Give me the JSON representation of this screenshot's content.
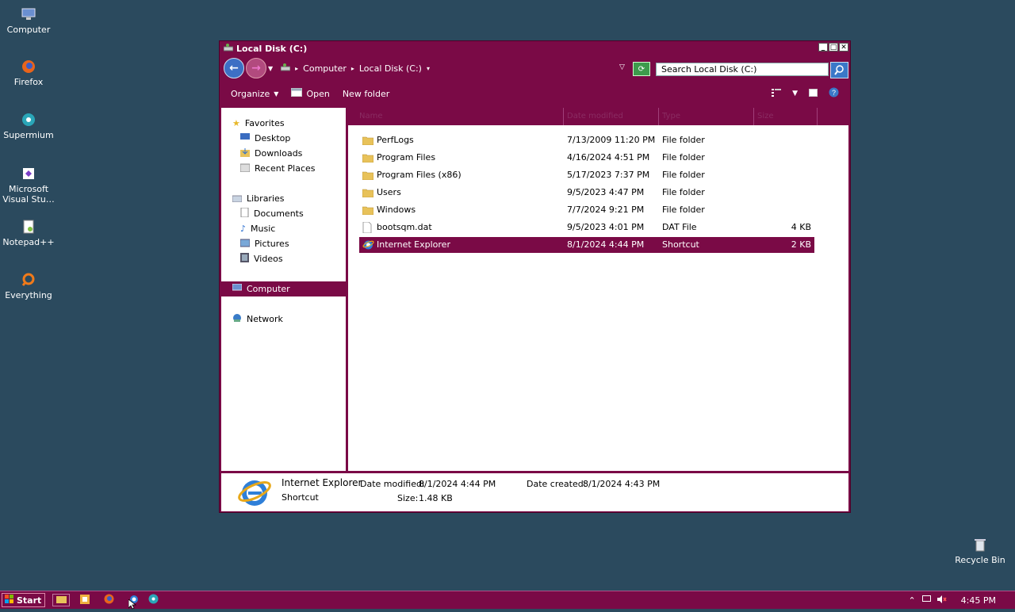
{
  "desktop": {
    "icons": [
      {
        "label": "Computer"
      },
      {
        "label": "Firefox"
      },
      {
        "label": "Supermium"
      },
      {
        "label": "Microsoft Visual Stu…"
      },
      {
        "label": "Notepad++"
      },
      {
        "label": "Everything"
      },
      {
        "label": "Recycle Bin"
      }
    ]
  },
  "window": {
    "title": "Local Disk (C:)",
    "breadcrumbs": [
      "Computer",
      "Local Disk (C:)"
    ],
    "search_placeholder": "Search Local Disk (C:)",
    "toolbar": {
      "organize": "Organize",
      "open": "Open",
      "new_folder": "New folder"
    },
    "nav": {
      "favorites": "Favorites",
      "desktop": "Desktop",
      "downloads": "Downloads",
      "recent": "Recent Places",
      "libraries": "Libraries",
      "documents": "Documents",
      "music": "Music",
      "pictures": "Pictures",
      "videos": "Videos",
      "computer": "Computer",
      "network": "Network"
    },
    "columns": {
      "name": "Name",
      "date": "Date modified",
      "type": "Type",
      "size": "Size"
    },
    "files": [
      {
        "name": "PerfLogs",
        "date": "7/13/2009 11:20 PM",
        "type": "File folder",
        "size": "",
        "icon": "folder-icon"
      },
      {
        "name": "Program Files",
        "date": "4/16/2024 4:51 PM",
        "type": "File folder",
        "size": "",
        "icon": "folder-icon"
      },
      {
        "name": "Program Files (x86)",
        "date": "5/17/2023 7:37 PM",
        "type": "File folder",
        "size": "",
        "icon": "folder-icon"
      },
      {
        "name": "Users",
        "date": "9/5/2023 4:47 PM",
        "type": "File folder",
        "size": "",
        "icon": "folder-icon"
      },
      {
        "name": "Windows",
        "date": "7/7/2024 9:21 PM",
        "type": "File folder",
        "size": "",
        "icon": "folder-icon"
      },
      {
        "name": "bootsqm.dat",
        "date": "9/5/2023 4:01 PM",
        "type": "DAT File",
        "size": "4 KB",
        "icon": "file-icon"
      },
      {
        "name": "Internet Explorer",
        "date": "8/1/2024 4:44 PM",
        "type": "Shortcut",
        "size": "2 KB",
        "icon": "ie-shortcut-icon"
      }
    ],
    "details": {
      "name": "Internet Explorer",
      "type": "Shortcut",
      "date_modified_label": "Date modified:",
      "date_modified": "8/1/2024 4:44 PM",
      "date_created_label": "Date created:",
      "date_created": "8/1/2024 4:43 PM",
      "size_label": "Size:",
      "size": "1.48 KB"
    }
  },
  "taskbar": {
    "start": "Start",
    "clock": "4:45 PM"
  },
  "colors": {
    "accent": "#7a0a46",
    "desktop": "#2b4a5e"
  }
}
